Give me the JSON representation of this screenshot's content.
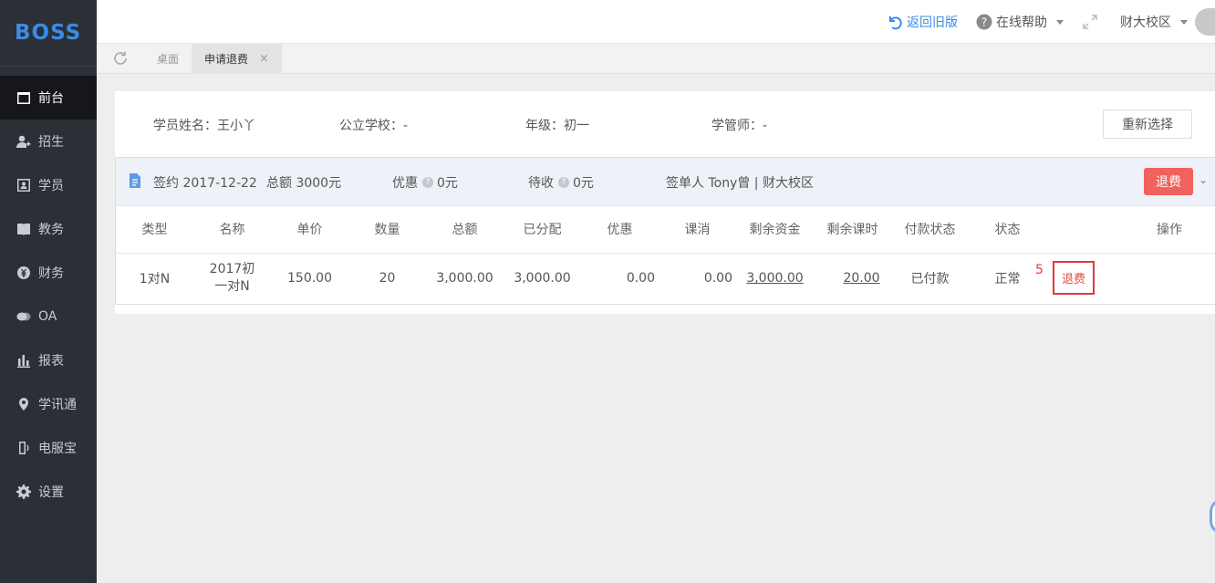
{
  "brand": {
    "logo": "BOSS",
    "accent": "#3c8ce7"
  },
  "sidebar": {
    "items": [
      {
        "label": "前台",
        "icon": "calendar-icon",
        "active": true
      },
      {
        "label": "招生",
        "icon": "user-add-icon",
        "active": false
      },
      {
        "label": "学员",
        "icon": "id-card-icon",
        "active": false
      },
      {
        "label": "教务",
        "icon": "book-icon",
        "active": false
      },
      {
        "label": "财务",
        "icon": "yen-icon",
        "active": false
      },
      {
        "label": "OA",
        "icon": "chat-icon",
        "active": false
      },
      {
        "label": "报表",
        "icon": "bar-chart-icon",
        "active": false
      },
      {
        "label": "学讯通",
        "icon": "location-pin-icon",
        "active": false
      },
      {
        "label": "电服宝",
        "icon": "phone-icon",
        "active": false
      },
      {
        "label": "设置",
        "icon": "gear-icon",
        "active": false
      }
    ]
  },
  "topbar": {
    "back_old": "返回旧版",
    "help": "在线帮助",
    "campus": "财大校区"
  },
  "tabs": [
    {
      "label": "桌面",
      "active": false
    },
    {
      "label": "申请退费",
      "active": true,
      "close": "×"
    }
  ],
  "student": {
    "name": "学员姓名：王小丫",
    "school": "公立学校：-",
    "grade": "年级：初一",
    "manager": "学管师：-",
    "reselect": "重新选择"
  },
  "contract": {
    "signed": "签约 2017-12-22",
    "total": "总额 3000元",
    "discount_label": "优惠",
    "discount_value": "0元",
    "pending_label": "待收",
    "pending_value": "0元",
    "signer": "签单人 Tony曾 | 财大校区",
    "refund_button": "退费"
  },
  "table": {
    "headers": [
      "类型",
      "名称",
      "单价",
      "数量",
      "总额",
      "已分配",
      "优惠",
      "课消",
      "剩余资金",
      "剩余课时",
      "付款状态",
      "状态",
      "",
      "操作"
    ],
    "row": {
      "type": "1对N",
      "name": "2017初一对N",
      "unit_price": "150.00",
      "quantity": "20",
      "total": "3,000.00",
      "allocated": "3,000.00",
      "discount": "0.00",
      "consumed": "0.00",
      "remaining_funds": "3,000.00",
      "remaining_hours": "20.00",
      "payment_status": "已付款",
      "status": "正常",
      "marker": "5",
      "action": "退费"
    }
  }
}
